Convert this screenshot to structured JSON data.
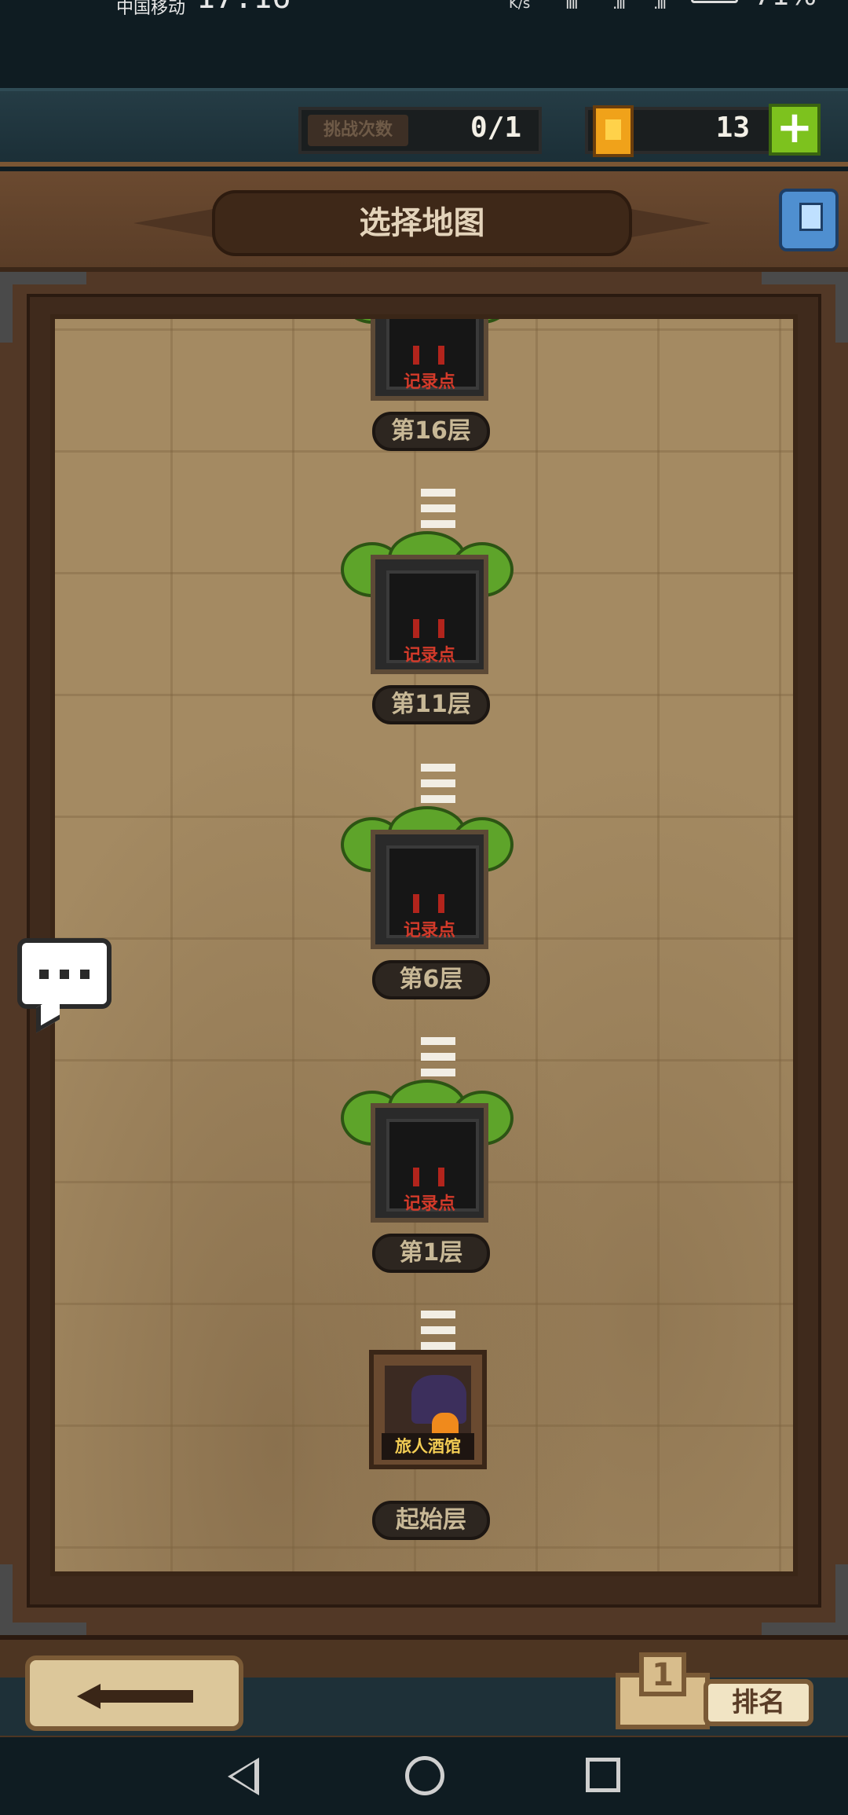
{
  "status_bar": {
    "carrier": "中国移动",
    "time": "17:16",
    "net_speed": "K/s",
    "battery_percent": "71%"
  },
  "resources": {
    "challenge_label": "挑战次数",
    "challenge_count": "0/1",
    "ticket_icon": "golden-ticket-icon",
    "ticket_count": "13",
    "add_label": "+"
  },
  "header": {
    "title": "选择地图",
    "settings_icon": "settings-icon"
  },
  "map": {
    "levels": [
      {
        "floor": "第16层",
        "marker": "记录点"
      },
      {
        "floor": "第11层",
        "marker": "记录点"
      },
      {
        "floor": "第6层",
        "marker": "记录点"
      },
      {
        "floor": "第1层",
        "marker": "记录点"
      }
    ],
    "start": {
      "floor": "起始层",
      "marker": "旅人酒馆"
    }
  },
  "chat_icon": "chat-bubble-icon",
  "footer": {
    "back_icon": "back-arrow-icon",
    "rank_number": "1",
    "rank_label": "排名"
  },
  "colors": {
    "accent_green": "#7dc21e",
    "marker_red": "#d33a2a",
    "inn_gold": "#f3cd54",
    "frame_brown": "#523826",
    "parchment": "#a48a62"
  }
}
